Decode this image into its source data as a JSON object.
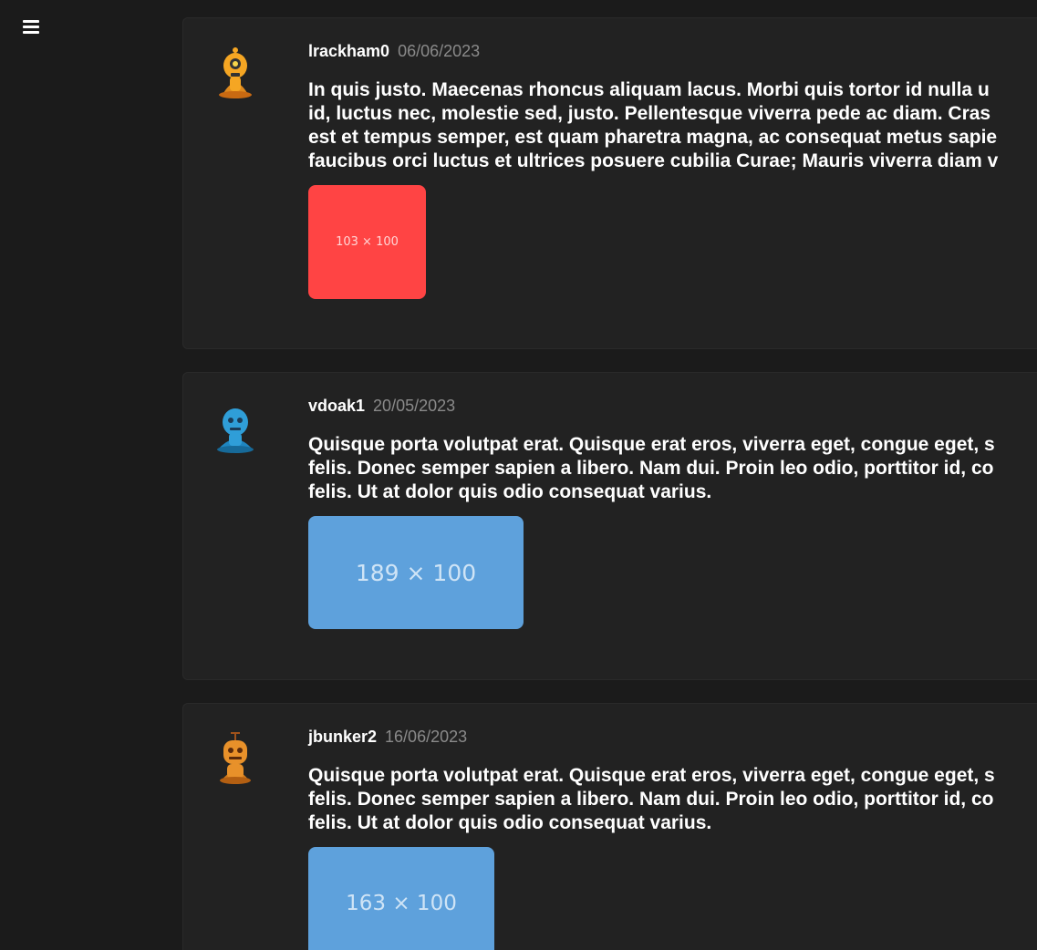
{
  "menu": {
    "icon": "hamburger-menu-icon"
  },
  "posts": [
    {
      "username": "lrackham0",
      "date": "06/06/2023",
      "avatar_icon": "orange-robot-avatar-icon",
      "body_lines": [
        "In quis justo. Maecenas rhoncus aliquam lacus. Morbi quis tortor id nulla u",
        "id, luctus nec, molestie sed, justo. Pellentesque viverra pede ac diam. Cras",
        "est et tempus semper, est quam pharetra magna, ac consequat metus sapie",
        "faucibus orci luctus et ultrices posuere cubilia Curae; Mauris viverra diam v"
      ],
      "image": {
        "label": "103 × 100",
        "color": "#ff4444"
      }
    },
    {
      "username": "vdoak1",
      "date": "20/05/2023",
      "avatar_icon": "blue-robot-avatar-icon",
      "body_lines": [
        "Quisque porta volutpat erat. Quisque erat eros, viverra eget, congue eget, s",
        "felis. Donec semper sapien a libero. Nam dui. Proin leo odio, porttitor id, co",
        "felis. Ut at dolor quis odio consequat varius."
      ],
      "image": {
        "label": "189 × 100",
        "color": "#5ea1dc"
      }
    },
    {
      "username": "jbunker2",
      "date": "16/06/2023",
      "avatar_icon": "orange-antenna-robot-avatar-icon",
      "body_lines": [
        "Quisque porta volutpat erat. Quisque erat eros, viverra eget, congue eget, s",
        "felis. Donec semper sapien a libero. Nam dui. Proin leo odio, porttitor id, co",
        "felis. Ut at dolor quis odio consequat varius."
      ],
      "image": {
        "label": "163 × 100",
        "color": "#5ea1dc"
      }
    }
  ]
}
